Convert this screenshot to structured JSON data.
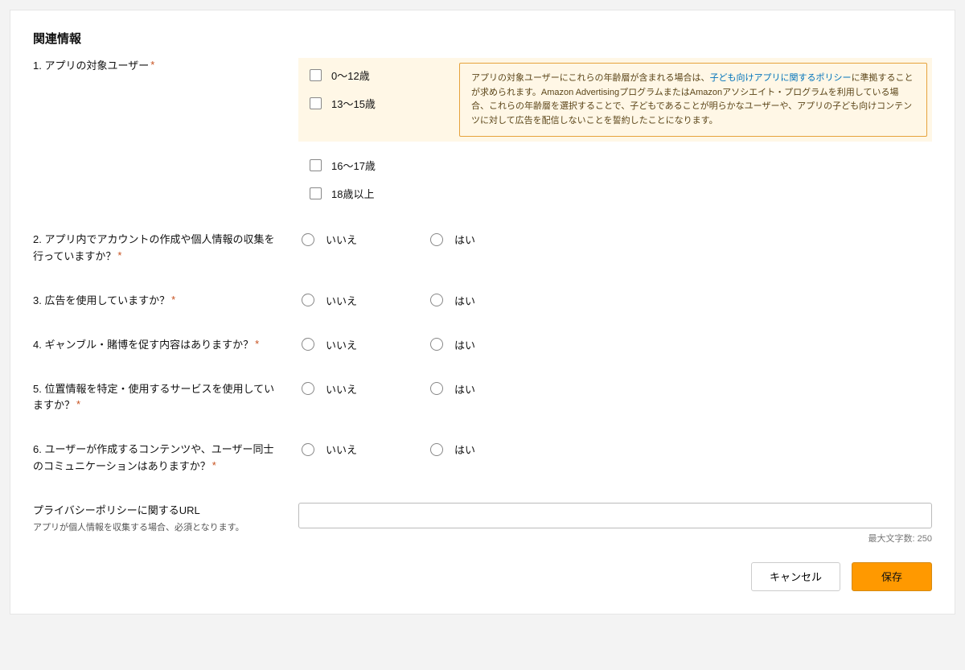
{
  "section_title": "関連情報",
  "q1": {
    "label": "1. アプリの対象ユーザー",
    "options": [
      "0〜12歳",
      "13〜15歳",
      "16〜17歳",
      "18歳以上"
    ],
    "notice_pre": "アプリの対象ユーザーにこれらの年齢層が含まれる場合は、",
    "notice_link": "子ども向けアプリに関するポリシー",
    "notice_post": "に準拠することが求められます。Amazon AdvertisingプログラムまたはAmazonアソシエイト・プログラムを利用している場合、これらの年齢層を選択することで、子どもであることが明らかなユーザーや、アプリの子ども向けコンテンツに対して広告を配信しないことを誓約したことになります。"
  },
  "radio_no": "いいえ",
  "radio_yes": "はい",
  "q2": {
    "label": "2. アプリ内でアカウントの作成や個人情報の収集を行っていますか？"
  },
  "q3": {
    "label": "3. 広告を使用していますか？"
  },
  "q4": {
    "label": "4. ギャンブル・賭博を促す内容はありますか？"
  },
  "q5": {
    "label": "5. 位置情報を特定・使用するサービスを使用していますか？"
  },
  "q6": {
    "label": "6. ユーザーが作成するコンテンツや、ユーザー同士のコミュニケーションはありますか？"
  },
  "privacy": {
    "label": "プライバシーポリシーに関するURL",
    "sub": "アプリが個人情報を収集する場合、必須となります。",
    "max_hint": "最大文字数: 250"
  },
  "buttons": {
    "cancel": "キャンセル",
    "save": "保存"
  }
}
